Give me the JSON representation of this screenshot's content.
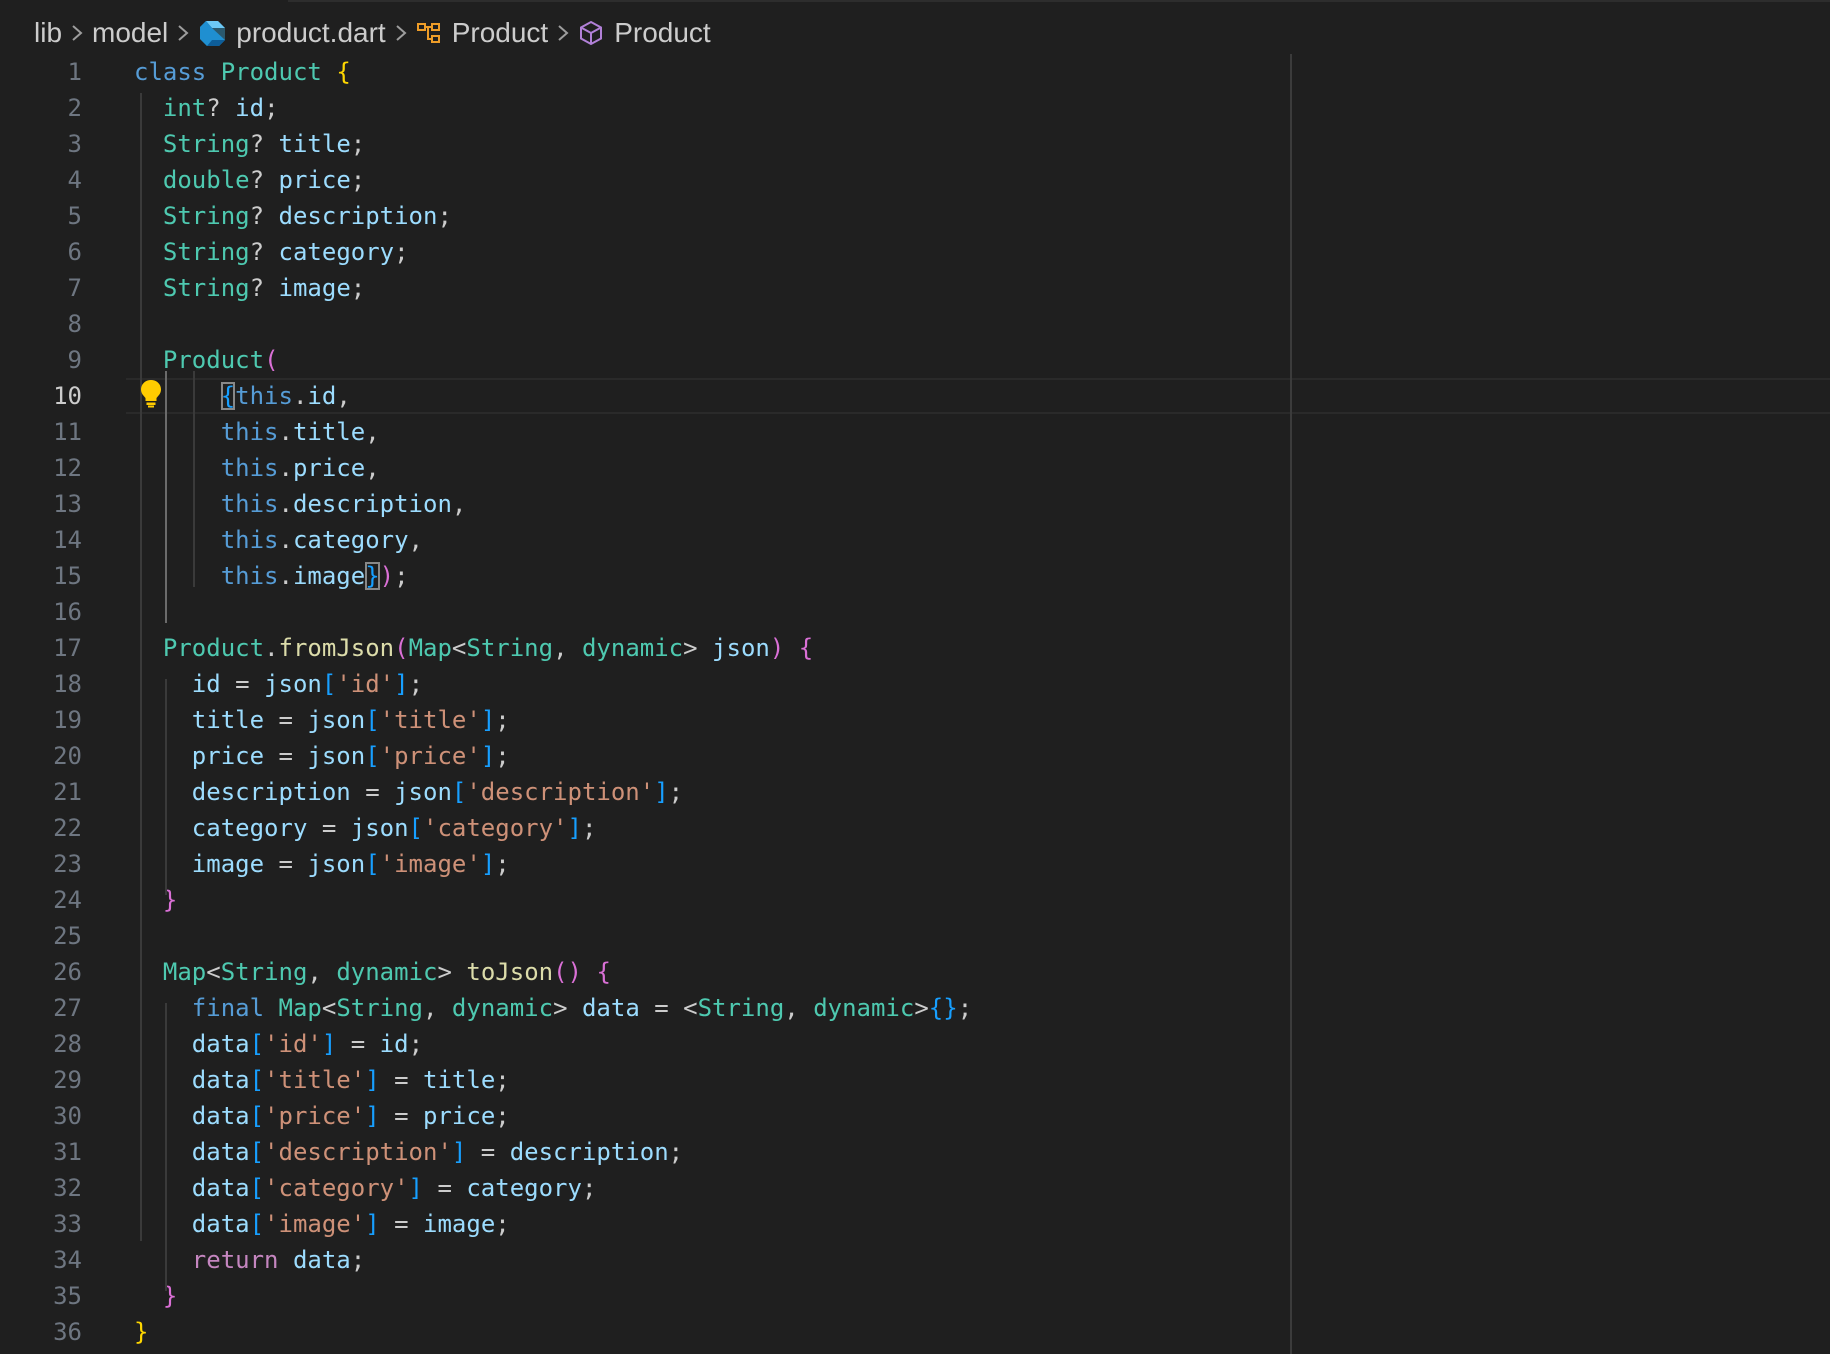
{
  "breadcrumb": {
    "items": [
      {
        "label": "lib",
        "icon": null
      },
      {
        "label": "model",
        "icon": null
      },
      {
        "label": "product.dart",
        "icon": "dart-file-icon"
      },
      {
        "label": "Product",
        "icon": "class-symbol-icon"
      },
      {
        "label": "Product",
        "icon": "constructor-symbol-icon"
      }
    ]
  },
  "editor": {
    "current_line": 10,
    "lightbulb_line": 10,
    "lines": [
      {
        "n": "1",
        "tokens": [
          [
            "kw",
            "class"
          ],
          [
            "pu",
            " "
          ],
          [
            "ty",
            "Product"
          ],
          [
            "pu",
            " "
          ],
          [
            "b1",
            "{"
          ]
        ]
      },
      {
        "n": "2",
        "tokens": [
          [
            "pu",
            "  "
          ],
          [
            "ty",
            "int"
          ],
          [
            "pu",
            "? "
          ],
          [
            "vr",
            "id"
          ],
          [
            "pu",
            ";"
          ]
        ]
      },
      {
        "n": "3",
        "tokens": [
          [
            "pu",
            "  "
          ],
          [
            "ty",
            "String"
          ],
          [
            "pu",
            "? "
          ],
          [
            "vr",
            "title"
          ],
          [
            "pu",
            ";"
          ]
        ]
      },
      {
        "n": "4",
        "tokens": [
          [
            "pu",
            "  "
          ],
          [
            "ty",
            "double"
          ],
          [
            "pu",
            "? "
          ],
          [
            "vr",
            "price"
          ],
          [
            "pu",
            ";"
          ]
        ]
      },
      {
        "n": "5",
        "tokens": [
          [
            "pu",
            "  "
          ],
          [
            "ty",
            "String"
          ],
          [
            "pu",
            "? "
          ],
          [
            "vr",
            "description"
          ],
          [
            "pu",
            ";"
          ]
        ]
      },
      {
        "n": "6",
        "tokens": [
          [
            "pu",
            "  "
          ],
          [
            "ty",
            "String"
          ],
          [
            "pu",
            "? "
          ],
          [
            "vr",
            "category"
          ],
          [
            "pu",
            ";"
          ]
        ]
      },
      {
        "n": "7",
        "tokens": [
          [
            "pu",
            "  "
          ],
          [
            "ty",
            "String"
          ],
          [
            "pu",
            "? "
          ],
          [
            "vr",
            "image"
          ],
          [
            "pu",
            ";"
          ]
        ]
      },
      {
        "n": "8",
        "tokens": []
      },
      {
        "n": "9",
        "tokens": [
          [
            "pu",
            "  "
          ],
          [
            "ty",
            "Product"
          ],
          [
            "b2",
            "("
          ]
        ]
      },
      {
        "n": "10",
        "tokens": [
          [
            "pu",
            "      "
          ],
          [
            "b3 match",
            "{"
          ],
          [
            "kw",
            "this"
          ],
          [
            "pu",
            "."
          ],
          [
            "vr",
            "id"
          ],
          [
            "pu",
            ","
          ]
        ]
      },
      {
        "n": "11",
        "tokens": [
          [
            "pu",
            "      "
          ],
          [
            "kw",
            "this"
          ],
          [
            "pu",
            "."
          ],
          [
            "vr",
            "title"
          ],
          [
            "pu",
            ","
          ]
        ]
      },
      {
        "n": "12",
        "tokens": [
          [
            "pu",
            "      "
          ],
          [
            "kw",
            "this"
          ],
          [
            "pu",
            "."
          ],
          [
            "vr",
            "price"
          ],
          [
            "pu",
            ","
          ]
        ]
      },
      {
        "n": "13",
        "tokens": [
          [
            "pu",
            "      "
          ],
          [
            "kw",
            "this"
          ],
          [
            "pu",
            "."
          ],
          [
            "vr",
            "description"
          ],
          [
            "pu",
            ","
          ]
        ]
      },
      {
        "n": "14",
        "tokens": [
          [
            "pu",
            "      "
          ],
          [
            "kw",
            "this"
          ],
          [
            "pu",
            "."
          ],
          [
            "vr",
            "category"
          ],
          [
            "pu",
            ","
          ]
        ]
      },
      {
        "n": "15",
        "tokens": [
          [
            "pu",
            "      "
          ],
          [
            "kw",
            "this"
          ],
          [
            "pu",
            "."
          ],
          [
            "vr",
            "image"
          ],
          [
            "b3 match",
            "}"
          ],
          [
            "b2",
            ")"
          ],
          [
            "pu",
            ";"
          ]
        ]
      },
      {
        "n": "16",
        "tokens": []
      },
      {
        "n": "17",
        "tokens": [
          [
            "pu",
            "  "
          ],
          [
            "ty",
            "Product"
          ],
          [
            "pu",
            "."
          ],
          [
            "fn",
            "fromJson"
          ],
          [
            "b2",
            "("
          ],
          [
            "ty",
            "Map"
          ],
          [
            "pu",
            "<"
          ],
          [
            "ty",
            "String"
          ],
          [
            "pu",
            ", "
          ],
          [
            "ty",
            "dynamic"
          ],
          [
            "pu",
            "> "
          ],
          [
            "vr",
            "json"
          ],
          [
            "b2",
            ")"
          ],
          [
            "pu",
            " "
          ],
          [
            "b2",
            "{"
          ]
        ]
      },
      {
        "n": "18",
        "tokens": [
          [
            "pu",
            "    "
          ],
          [
            "vr",
            "id"
          ],
          [
            "pu",
            " = "
          ],
          [
            "vr",
            "json"
          ],
          [
            "b3",
            "["
          ],
          [
            "st",
            "'id'"
          ],
          [
            "b3",
            "]"
          ],
          [
            "pu",
            ";"
          ]
        ]
      },
      {
        "n": "19",
        "tokens": [
          [
            "pu",
            "    "
          ],
          [
            "vr",
            "title"
          ],
          [
            "pu",
            " = "
          ],
          [
            "vr",
            "json"
          ],
          [
            "b3",
            "["
          ],
          [
            "st",
            "'title'"
          ],
          [
            "b3",
            "]"
          ],
          [
            "pu",
            ";"
          ]
        ]
      },
      {
        "n": "20",
        "tokens": [
          [
            "pu",
            "    "
          ],
          [
            "vr",
            "price"
          ],
          [
            "pu",
            " = "
          ],
          [
            "vr",
            "json"
          ],
          [
            "b3",
            "["
          ],
          [
            "st",
            "'price'"
          ],
          [
            "b3",
            "]"
          ],
          [
            "pu",
            ";"
          ]
        ]
      },
      {
        "n": "21",
        "tokens": [
          [
            "pu",
            "    "
          ],
          [
            "vr",
            "description"
          ],
          [
            "pu",
            " = "
          ],
          [
            "vr",
            "json"
          ],
          [
            "b3",
            "["
          ],
          [
            "st",
            "'description'"
          ],
          [
            "b3",
            "]"
          ],
          [
            "pu",
            ";"
          ]
        ]
      },
      {
        "n": "22",
        "tokens": [
          [
            "pu",
            "    "
          ],
          [
            "vr",
            "category"
          ],
          [
            "pu",
            " = "
          ],
          [
            "vr",
            "json"
          ],
          [
            "b3",
            "["
          ],
          [
            "st",
            "'category'"
          ],
          [
            "b3",
            "]"
          ],
          [
            "pu",
            ";"
          ]
        ]
      },
      {
        "n": "23",
        "tokens": [
          [
            "pu",
            "    "
          ],
          [
            "vr",
            "image"
          ],
          [
            "pu",
            " = "
          ],
          [
            "vr",
            "json"
          ],
          [
            "b3",
            "["
          ],
          [
            "st",
            "'image'"
          ],
          [
            "b3",
            "]"
          ],
          [
            "pu",
            ";"
          ]
        ]
      },
      {
        "n": "24",
        "tokens": [
          [
            "pu",
            "  "
          ],
          [
            "b2",
            "}"
          ]
        ]
      },
      {
        "n": "25",
        "tokens": []
      },
      {
        "n": "26",
        "tokens": [
          [
            "pu",
            "  "
          ],
          [
            "ty",
            "Map"
          ],
          [
            "pu",
            "<"
          ],
          [
            "ty",
            "String"
          ],
          [
            "pu",
            ", "
          ],
          [
            "ty",
            "dynamic"
          ],
          [
            "pu",
            "> "
          ],
          [
            "fn",
            "toJson"
          ],
          [
            "b2",
            "()"
          ],
          [
            "pu",
            " "
          ],
          [
            "b2",
            "{"
          ]
        ]
      },
      {
        "n": "27",
        "tokens": [
          [
            "pu",
            "    "
          ],
          [
            "kw",
            "final"
          ],
          [
            "pu",
            " "
          ],
          [
            "ty",
            "Map"
          ],
          [
            "pu",
            "<"
          ],
          [
            "ty",
            "String"
          ],
          [
            "pu",
            ", "
          ],
          [
            "ty",
            "dynamic"
          ],
          [
            "pu",
            "> "
          ],
          [
            "vr",
            "data"
          ],
          [
            "pu",
            " = <"
          ],
          [
            "ty",
            "String"
          ],
          [
            "pu",
            ", "
          ],
          [
            "ty",
            "dynamic"
          ],
          [
            "pu",
            ">"
          ],
          [
            "b3",
            "{}"
          ],
          [
            "pu",
            ";"
          ]
        ]
      },
      {
        "n": "28",
        "tokens": [
          [
            "pu",
            "    "
          ],
          [
            "vr",
            "data"
          ],
          [
            "b3",
            "["
          ],
          [
            "st",
            "'id'"
          ],
          [
            "b3",
            "]"
          ],
          [
            "pu",
            " = "
          ],
          [
            "vr",
            "id"
          ],
          [
            "pu",
            ";"
          ]
        ]
      },
      {
        "n": "29",
        "tokens": [
          [
            "pu",
            "    "
          ],
          [
            "vr",
            "data"
          ],
          [
            "b3",
            "["
          ],
          [
            "st",
            "'title'"
          ],
          [
            "b3",
            "]"
          ],
          [
            "pu",
            " = "
          ],
          [
            "vr",
            "title"
          ],
          [
            "pu",
            ";"
          ]
        ]
      },
      {
        "n": "30",
        "tokens": [
          [
            "pu",
            "    "
          ],
          [
            "vr",
            "data"
          ],
          [
            "b3",
            "["
          ],
          [
            "st",
            "'price'"
          ],
          [
            "b3",
            "]"
          ],
          [
            "pu",
            " = "
          ],
          [
            "vr",
            "price"
          ],
          [
            "pu",
            ";"
          ]
        ]
      },
      {
        "n": "31",
        "tokens": [
          [
            "pu",
            "    "
          ],
          [
            "vr",
            "data"
          ],
          [
            "b3",
            "["
          ],
          [
            "st",
            "'description'"
          ],
          [
            "b3",
            "]"
          ],
          [
            "pu",
            " = "
          ],
          [
            "vr",
            "description"
          ],
          [
            "pu",
            ";"
          ]
        ]
      },
      {
        "n": "32",
        "tokens": [
          [
            "pu",
            "    "
          ],
          [
            "vr",
            "data"
          ],
          [
            "b3",
            "["
          ],
          [
            "st",
            "'category'"
          ],
          [
            "b3",
            "]"
          ],
          [
            "pu",
            " = "
          ],
          [
            "vr",
            "category"
          ],
          [
            "pu",
            ";"
          ]
        ]
      },
      {
        "n": "33",
        "tokens": [
          [
            "pu",
            "    "
          ],
          [
            "vr",
            "data"
          ],
          [
            "b3",
            "["
          ],
          [
            "st",
            "'image'"
          ],
          [
            "b3",
            "]"
          ],
          [
            "pu",
            " = "
          ],
          [
            "vr",
            "image"
          ],
          [
            "pu",
            ";"
          ]
        ]
      },
      {
        "n": "34",
        "tokens": [
          [
            "pu",
            "    "
          ],
          [
            "ctl",
            "return"
          ],
          [
            "pu",
            " "
          ],
          [
            "vr",
            "data"
          ],
          [
            "pu",
            ";"
          ]
        ]
      },
      {
        "n": "35",
        "tokens": [
          [
            "pu",
            "  "
          ],
          [
            "b2",
            "}"
          ]
        ]
      },
      {
        "n": "36",
        "tokens": [
          [
            "b1",
            "}"
          ]
        ]
      }
    ]
  }
}
